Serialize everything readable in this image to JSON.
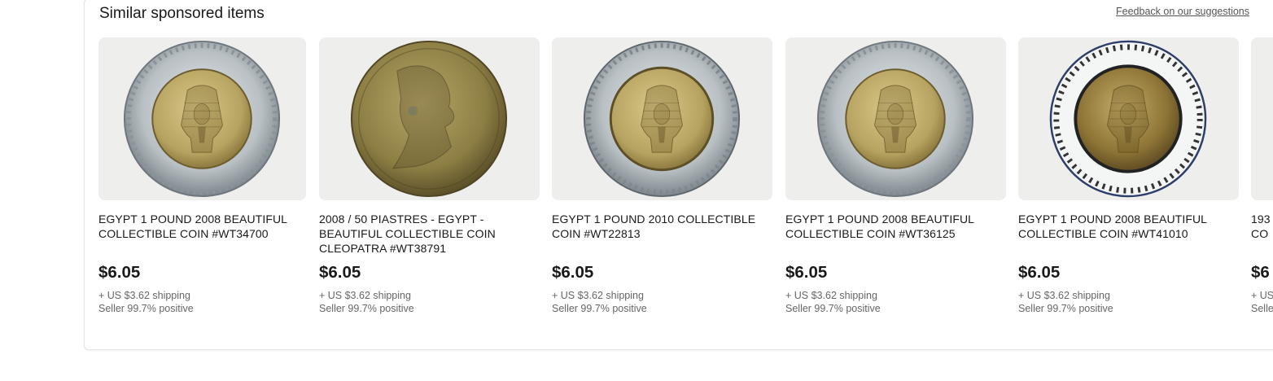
{
  "header": {
    "title": "Similar sponsored items",
    "feedback_link": "Feedback on our suggestions"
  },
  "colors": {
    "price_text": "#191919",
    "meta_text": "#666666",
    "thumb_bg": "#eeeeed"
  },
  "items": [
    {
      "title": "EGYPT 1 POUND 2008 BEAUTIFUL COLLECTIBLE COIN #WT34700",
      "price": "$6.05",
      "shipping": "+ US $3.62 shipping",
      "seller": "Seller 99.7% positive",
      "image": "bimetal-pharaoh-coin"
    },
    {
      "title": "2008 / 50 PIASTRES - EGYPT - BEAUTIFUL COLLECTIBLE COIN CLEOPATRA #WT38791",
      "price": "$6.05",
      "shipping": "+ US $3.62 shipping",
      "seller": "Seller 99.7% positive",
      "image": "brass-cleopatra-coin"
    },
    {
      "title": "EGYPT 1 POUND 2010 COLLECTIBLE COIN #WT22813",
      "price": "$6.05",
      "shipping": "+ US $3.62 shipping",
      "seller": "Seller 99.7% positive",
      "image": "bimetal-pharaoh-coin"
    },
    {
      "title": "EGYPT 1 POUND 2008 BEAUTIFUL COLLECTIBLE COIN #WT36125",
      "price": "$6.05",
      "shipping": "+ US $3.62 shipping",
      "seller": "Seller 99.7% positive",
      "image": "bimetal-pharaoh-coin"
    },
    {
      "title": "EGYPT 1 POUND 2008 BEAUTIFUL COLLECTIBLE COIN #WT41010",
      "price": "$6.05",
      "shipping": "+ US $3.62 shipping",
      "seller": "Seller 99.7% positive",
      "image": "bimetal-pharaoh-coin-bright"
    },
    {
      "title": "193",
      "title_line2": "CO",
      "price": "$6",
      "shipping": "+ US",
      "seller": "Selle",
      "image": "partial-coin"
    }
  ]
}
